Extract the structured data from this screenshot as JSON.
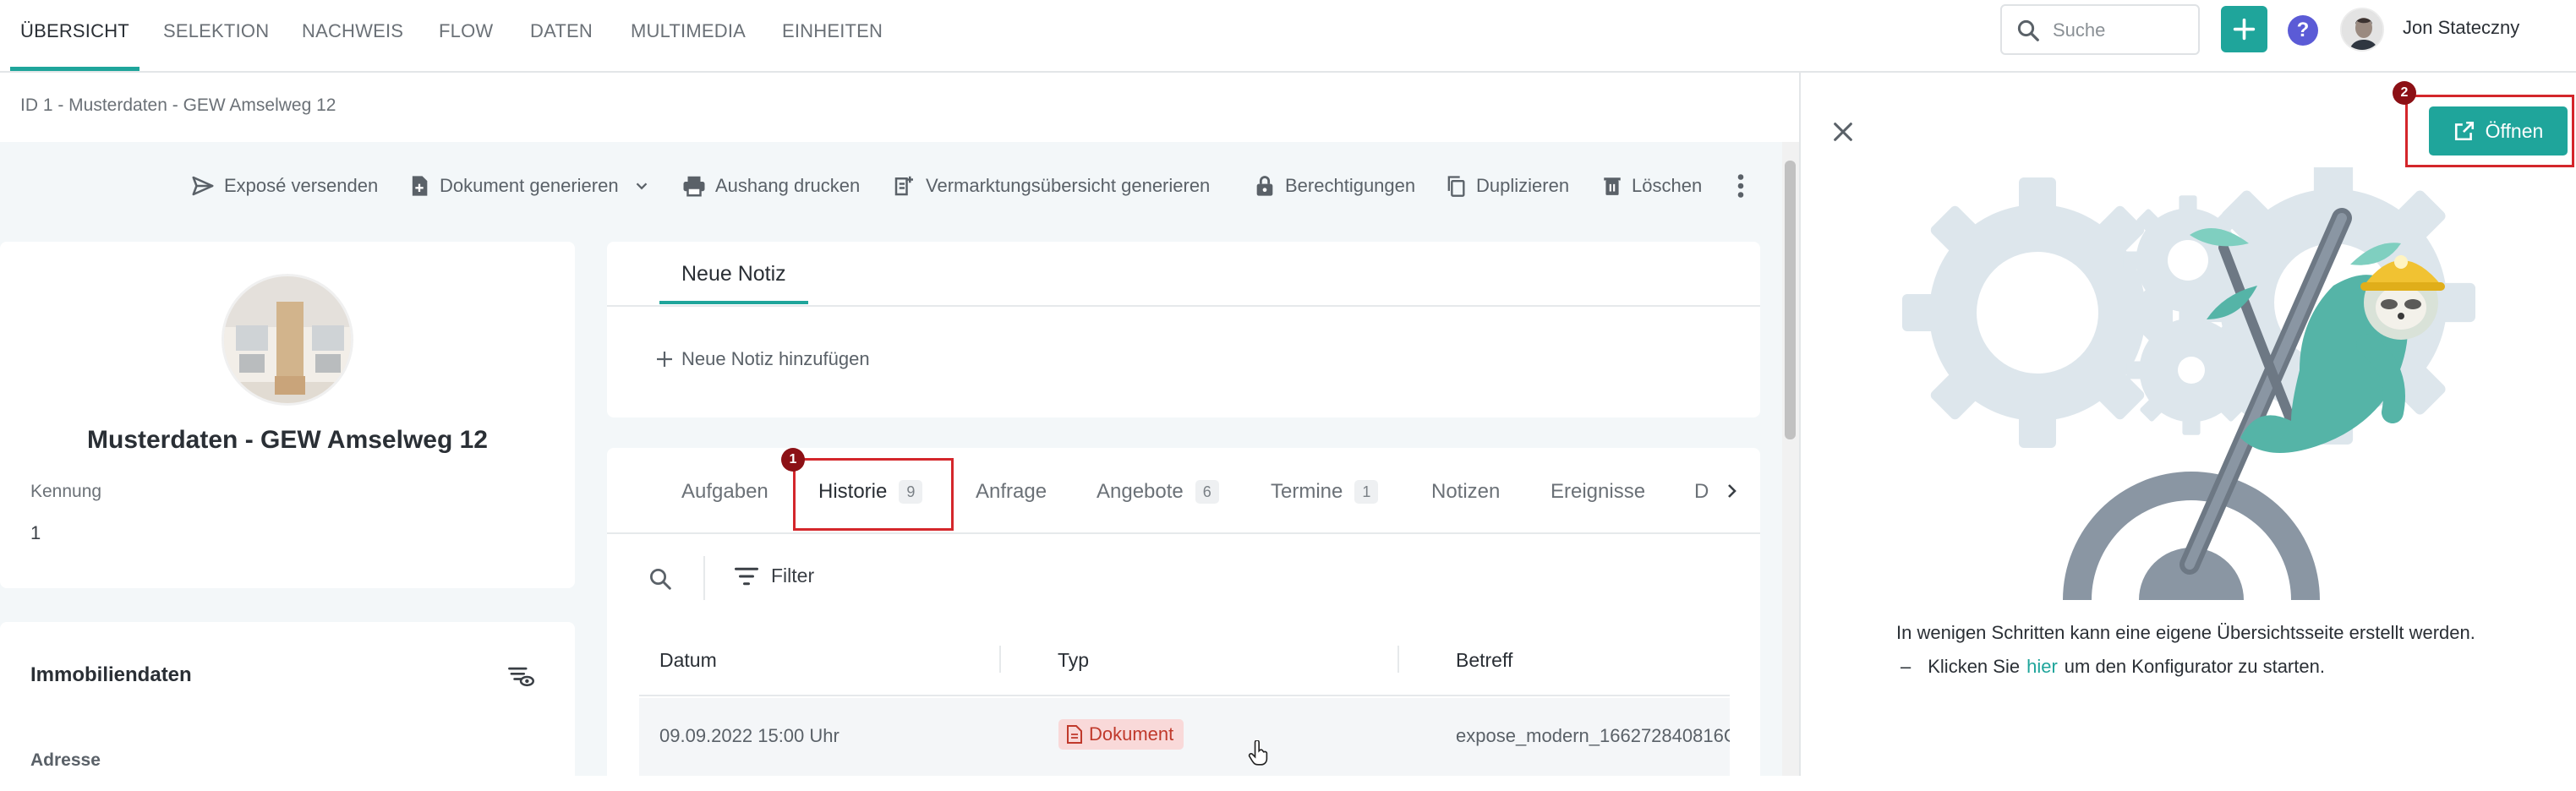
{
  "nav": {
    "tabs": [
      "ÜBERSICHT",
      "SELEKTION",
      "NACHWEIS",
      "FLOW",
      "DATEN",
      "MULTIMEDIA",
      "EINHEITEN"
    ],
    "active_index": 0,
    "search_placeholder": "Suche",
    "user_name": "Jon Stateczny",
    "help_label": "?"
  },
  "breadcrumb": "ID 1 - Musterdaten - GEW Amselweg 12",
  "toolbar": {
    "expose": "Exposé versenden",
    "document": "Dokument generieren",
    "aushang": "Aushang drucken",
    "vermarktung": "Vermarktungsübersicht generieren",
    "berechtigungen": "Berechtigungen",
    "duplizieren": "Duplizieren",
    "loeschen": "Löschen"
  },
  "property": {
    "title": "Musterdaten - GEW Amselweg 12",
    "kennung_label": "Kennung",
    "kennung_value": "1"
  },
  "immobiliendaten": {
    "title": "Immobiliendaten",
    "adresse_label": "Adresse"
  },
  "notes": {
    "tab": "Neue Notiz",
    "add": "Neue Notiz hinzufügen"
  },
  "activity": {
    "tabs": [
      {
        "label": "Aufgaben",
        "count": ""
      },
      {
        "label": "Historie",
        "count": "9"
      },
      {
        "label": "Anfrage",
        "count": ""
      },
      {
        "label": "Angebote",
        "count": "6"
      },
      {
        "label": "Termine",
        "count": "1"
      },
      {
        "label": "Notizen",
        "count": ""
      },
      {
        "label": "Ereignisse",
        "count": ""
      },
      {
        "label": "D",
        "count": ""
      }
    ],
    "filter_label": "Filter",
    "columns": [
      "Datum",
      "Typ",
      "Betreff"
    ],
    "rows": [
      {
        "datum": "09.09.2022 15:00 Uhr",
        "typ": "Dokument",
        "betreff": "expose_modern_166272840816C"
      }
    ]
  },
  "annotations": {
    "one": "1",
    "two": "2"
  },
  "right_panel": {
    "open_button": "Öffnen",
    "description": "In wenigen Schritten kann eine eigene Übersichtsseite erstellt werden.",
    "bullet_dash": "–",
    "bullet_before": "Klicken Sie",
    "bullet_link": "hier",
    "bullet_after": "um den Konfigurator zu starten."
  },
  "colors": {
    "accent": "#1fa59b",
    "highlight": "#d4262b",
    "badge_bg": "#f9d9d9",
    "badge_text": "#c0392b"
  },
  "icons": [
    "search-icon",
    "plus-icon",
    "help-icon",
    "send-icon",
    "file-plus-icon",
    "chevron-down-icon",
    "printer-icon",
    "document-edit-icon",
    "lock-icon",
    "copy-icon",
    "trash-icon",
    "more-vertical-icon",
    "eye-filter-icon",
    "filter-icon",
    "chevron-right-icon",
    "close-icon",
    "external-link-icon",
    "document-icon",
    "cursor-hand-icon"
  ]
}
